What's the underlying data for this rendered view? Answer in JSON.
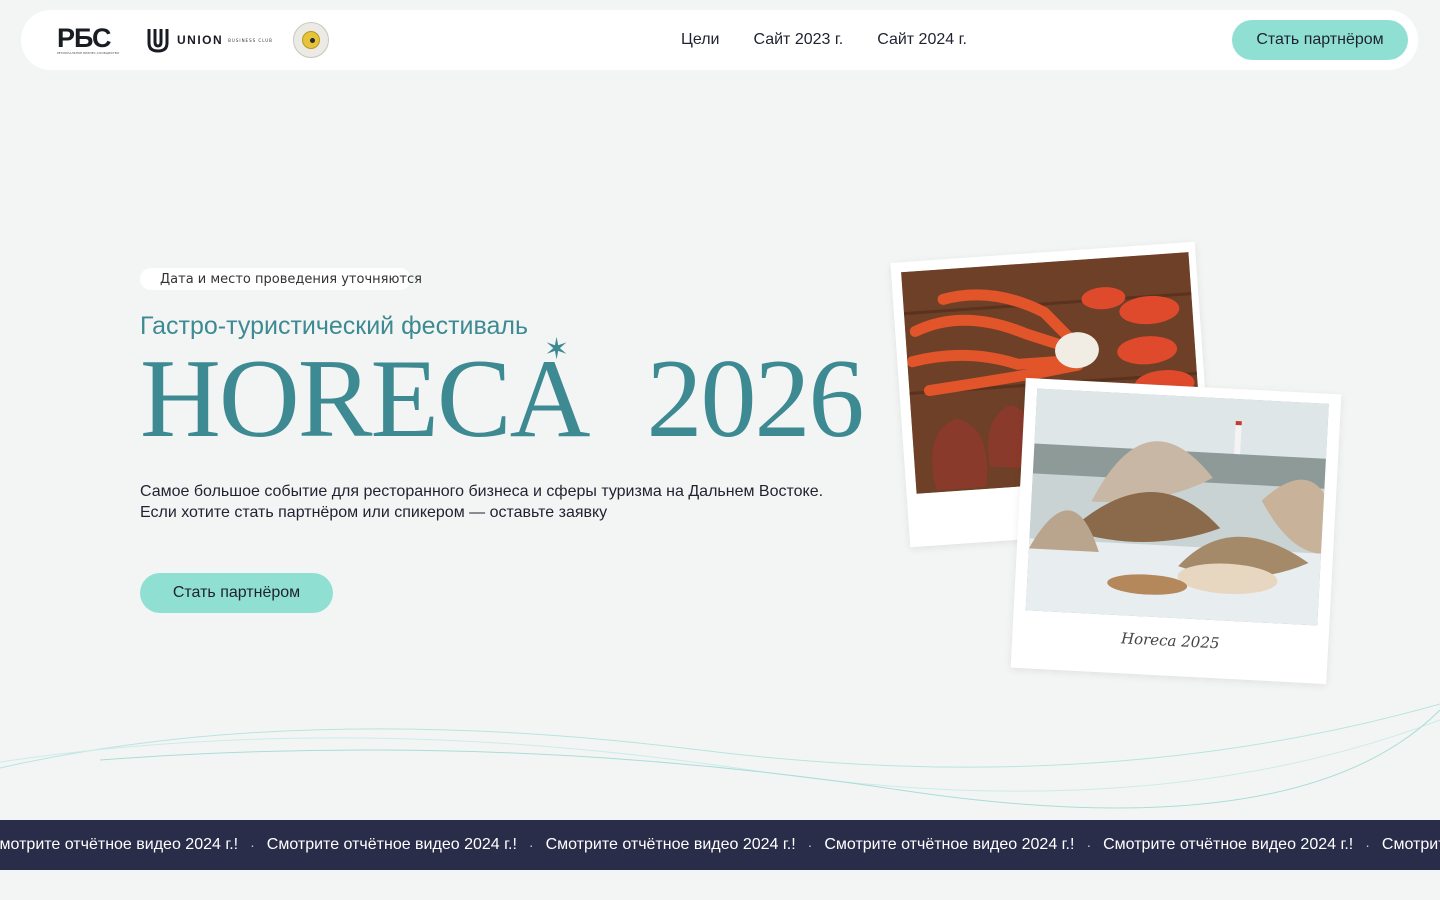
{
  "header": {
    "logo_rbs": "РБС",
    "logo_rbs_sub": "РЕГИОНАЛЬНОЕ БИЗНЕС-СООБЩЕСТВО",
    "logo_union": "UNION",
    "logo_union_sub": "BUSINESS CLUB",
    "nav": [
      "Цели",
      "Сайт 2023 г.",
      "Сайт 2024 г."
    ],
    "cta_label": "Стать партнёром"
  },
  "hero": {
    "date_badge": "Дата и место проведения уточняются",
    "subtitle": "Гастро-туристический фестиваль",
    "title_word": "HORECA",
    "title_year": "2026",
    "description_line1": "Самое большое событие для ресторанного бизнеса и сферы туризма на Дальнем Востоке.",
    "description_line2": "Если хотите стать партнёром или спикером — оставьте заявку",
    "cta_label": "Стать партнёром"
  },
  "photos": {
    "caption": "Horeca 2025"
  },
  "ticker": {
    "item": "Смотрите отчётное видео 2024 г.!",
    "separator": "·"
  },
  "colors": {
    "accent": "#3e8a93",
    "button": "#8fe0d2",
    "ticker_bg": "#2a2d4a",
    "page_bg": "#f3f5f4"
  }
}
